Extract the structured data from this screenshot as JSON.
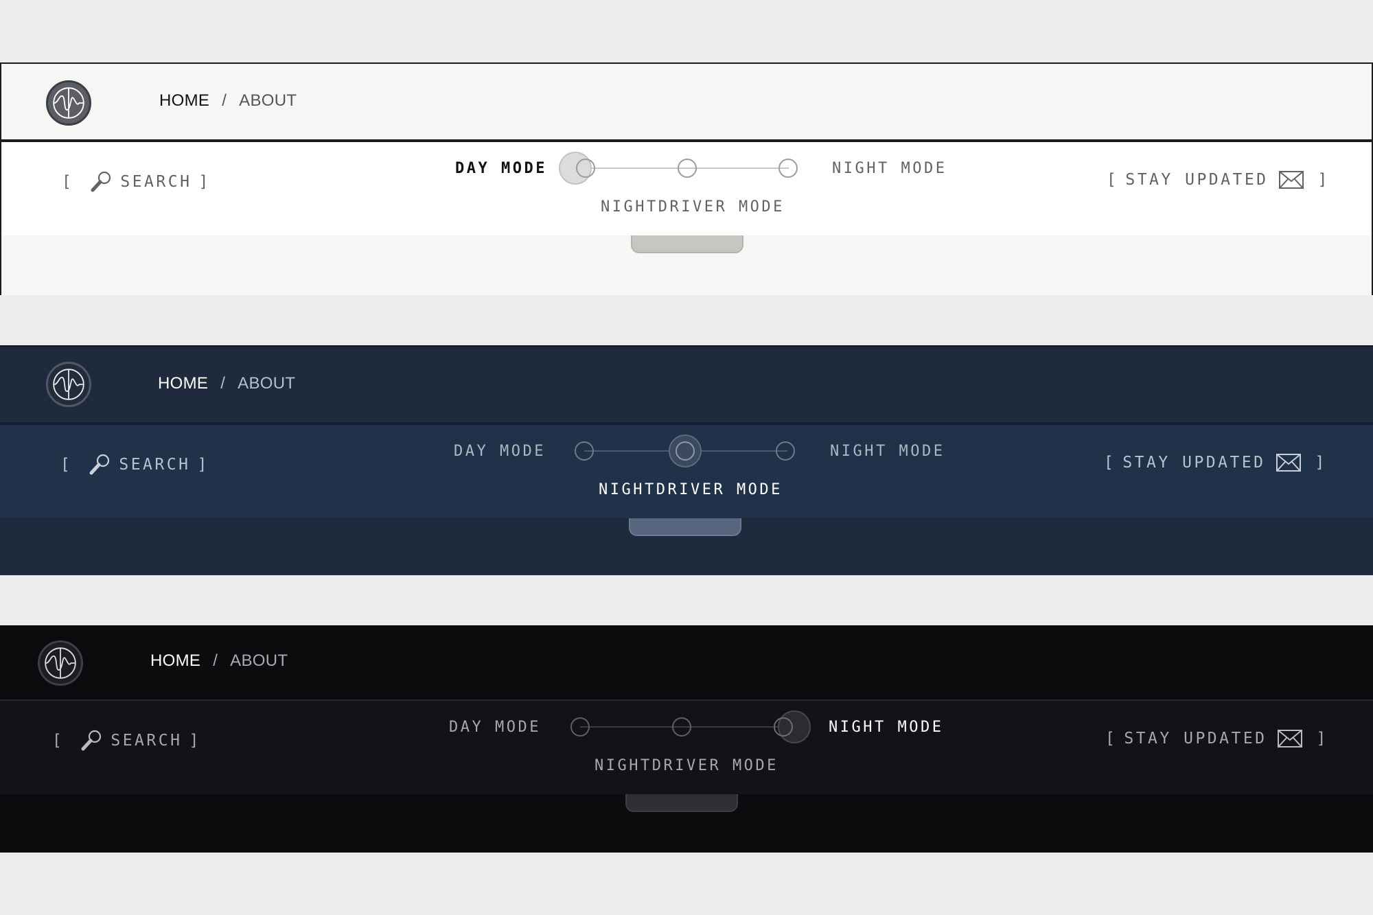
{
  "breadcrumb": {
    "home": "HOME",
    "separator": "/",
    "about": "ABOUT"
  },
  "search": {
    "open": "[",
    "label": "SEARCH",
    "close": "]"
  },
  "newsletter": {
    "open": "[",
    "label": "STAY UPDATED",
    "close": "]"
  },
  "theme_switch": {
    "day_label": "DAY MODE",
    "night_label": "NIGHT MODE",
    "nightdriver_label": "NIGHTDRIVER MODE"
  },
  "icons": {
    "logo": "waveform-logo-icon",
    "search": "magnifier-icon",
    "newsletter": "envelope-icon"
  },
  "themes": [
    {
      "name": "day",
      "selected": "DAY MODE",
      "background": "#f6f6f4",
      "toolbar": "#ffffff"
    },
    {
      "name": "nightdriver",
      "selected": "NIGHTDRIVER MODE",
      "background": "#1f2a3d",
      "toolbar": "#1f3249"
    },
    {
      "name": "night",
      "selected": "NIGHT MODE",
      "background": "#0b0c0e",
      "toolbar": "#121317"
    }
  ]
}
